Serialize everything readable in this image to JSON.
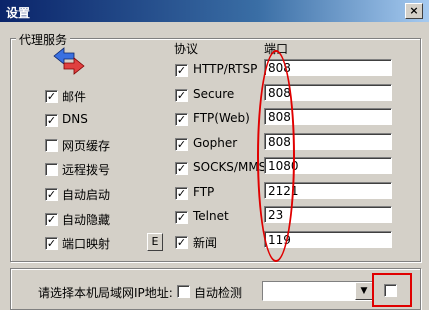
{
  "window": {
    "title": "设置",
    "close_glyph": "×"
  },
  "proxy": {
    "group_title": "代理服务",
    "protocol_header": "协议",
    "port_header": "端口",
    "services": [
      {
        "label": "邮件",
        "checked": true
      },
      {
        "label": "DNS",
        "checked": true
      },
      {
        "label": "网页缓存",
        "checked": false
      },
      {
        "label": "远程拨号",
        "checked": false
      },
      {
        "label": "自动启动",
        "checked": true
      },
      {
        "label": "自动隐藏",
        "checked": true
      },
      {
        "label": "端口映射",
        "checked": true
      }
    ],
    "e_button": "E",
    "protocols": [
      {
        "label": "HTTP/RTSP",
        "checked": true,
        "port": "808"
      },
      {
        "label": "Secure",
        "checked": true,
        "port": "808"
      },
      {
        "label": "FTP(Web)",
        "checked": true,
        "port": "808"
      },
      {
        "label": "Gopher",
        "checked": true,
        "port": "808"
      },
      {
        "label": "SOCKS/MMS",
        "checked": true,
        "port": "1080"
      },
      {
        "label": "FTP",
        "checked": true,
        "port": "2121"
      },
      {
        "label": "Telnet",
        "checked": true,
        "port": "23"
      },
      {
        "label": "新闻",
        "checked": true,
        "port": "119"
      }
    ]
  },
  "lan": {
    "prompt": "请选择本机局域网IP地址:",
    "auto_detect_label": "自动检测",
    "auto_detect_checked": false,
    "ip_value": "",
    "extra_checked": false
  },
  "colors": {
    "highlight": "#e00000",
    "face": "#d4d0c8"
  }
}
